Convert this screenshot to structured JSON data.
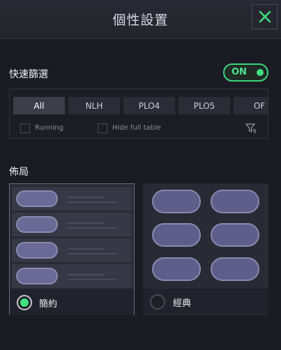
{
  "header": {
    "title": "個性設置",
    "close_icon": "close-icon"
  },
  "quick_filter": {
    "title": "快速篩選",
    "toggle_label": "ON",
    "tabs": [
      "All",
      "NLH",
      "PLO4",
      "PLO5",
      "OF"
    ],
    "selected_tab": "All",
    "checkboxes": [
      {
        "label": "Running"
      },
      {
        "label": "Hide full table"
      }
    ],
    "filter_icon": "filter-settings-icon"
  },
  "layout": {
    "title": "佈局",
    "options": [
      {
        "label": "簡約",
        "selected": true
      },
      {
        "label": "經典",
        "selected": false
      }
    ]
  },
  "colors": {
    "accent": "#3ee07f",
    "background": "#1b1b24",
    "pill": "#6a6a96"
  }
}
